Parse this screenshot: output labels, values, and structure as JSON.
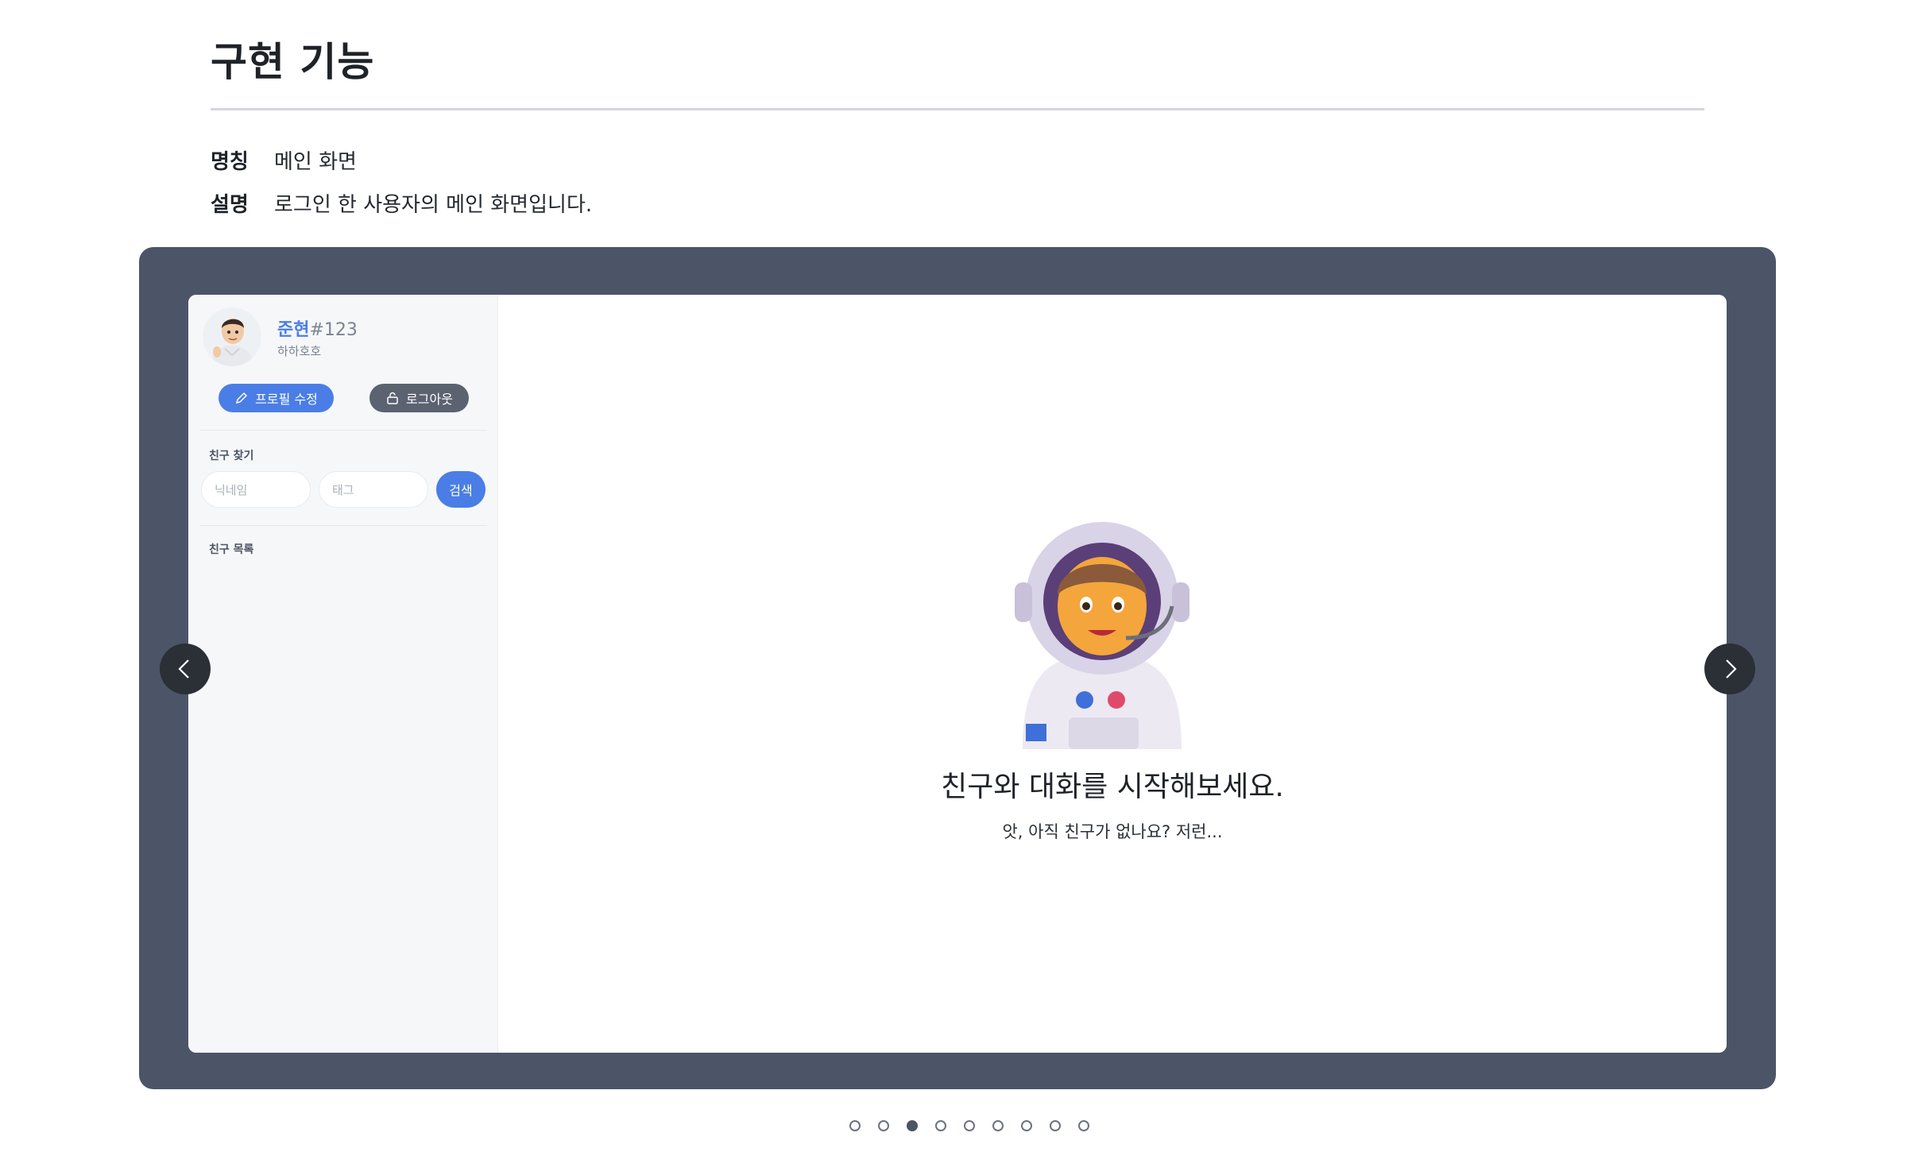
{
  "section": {
    "title": "구현 기능"
  },
  "meta": {
    "name_key": "명칭",
    "name_value": "메인 화면",
    "desc_key": "설명",
    "desc_value": "로그인 한 사용자의 메인 화면입니다."
  },
  "slide": {
    "user": {
      "nickname": "준현",
      "tag": "#123",
      "status": "하하호호"
    },
    "buttons": {
      "edit_profile": "프로필 수정",
      "logout": "로그아웃"
    },
    "find_friend": {
      "label": "친구 찾기",
      "nickname_placeholder": "닉네임",
      "tag_placeholder": "태그",
      "search": "검색"
    },
    "friend_list": {
      "label": "친구 목록"
    },
    "empty": {
      "title": "친구와 대화를 시작해보세요.",
      "subtitle": "앗, 아직 친구가 없나요? 저런..."
    }
  },
  "carousel": {
    "active_index": 3,
    "total": 9
  },
  "colors": {
    "accent": "#4a7ee6",
    "frame": "#4b5567"
  },
  "icons": {
    "prev": "chevron-left-icon",
    "next": "chevron-right-icon",
    "edit": "pencil-icon",
    "logout": "lock-icon"
  }
}
